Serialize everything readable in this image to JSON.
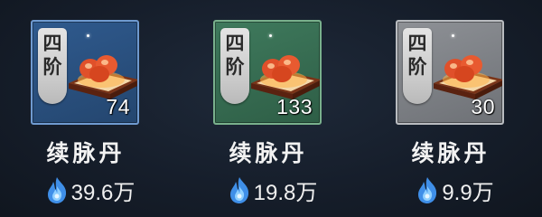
{
  "items": [
    {
      "tier_chars": [
        "四",
        "阶"
      ],
      "quantity": "74",
      "name": "续脉丹",
      "price": "39.6万",
      "icon": "elixir-pill-on-tray-icon",
      "currency_icon": "blue-flame-currency-icon",
      "colors": {
        "border": "#6f9ad0",
        "bg1": "#2f5a8e",
        "bg2": "#24466f"
      }
    },
    {
      "tier_chars": [
        "四",
        "阶"
      ],
      "quantity": "133",
      "name": "续脉丹",
      "price": "19.8万",
      "icon": "elixir-pill-on-tray-icon",
      "currency_icon": "blue-flame-currency-icon",
      "colors": {
        "border": "#79b08c",
        "bg1": "#3f7a5d",
        "bg2": "#2e5e46"
      }
    },
    {
      "tier_chars": [
        "四",
        "阶"
      ],
      "quantity": "30",
      "name": "续脉丹",
      "price": "9.9万",
      "icon": "elixir-pill-on-tray-icon",
      "currency_icon": "blue-flame-currency-icon",
      "colors": {
        "border": "#b9bcc0",
        "bg1": "#8e9196",
        "bg2": "#6e7176"
      }
    }
  ]
}
